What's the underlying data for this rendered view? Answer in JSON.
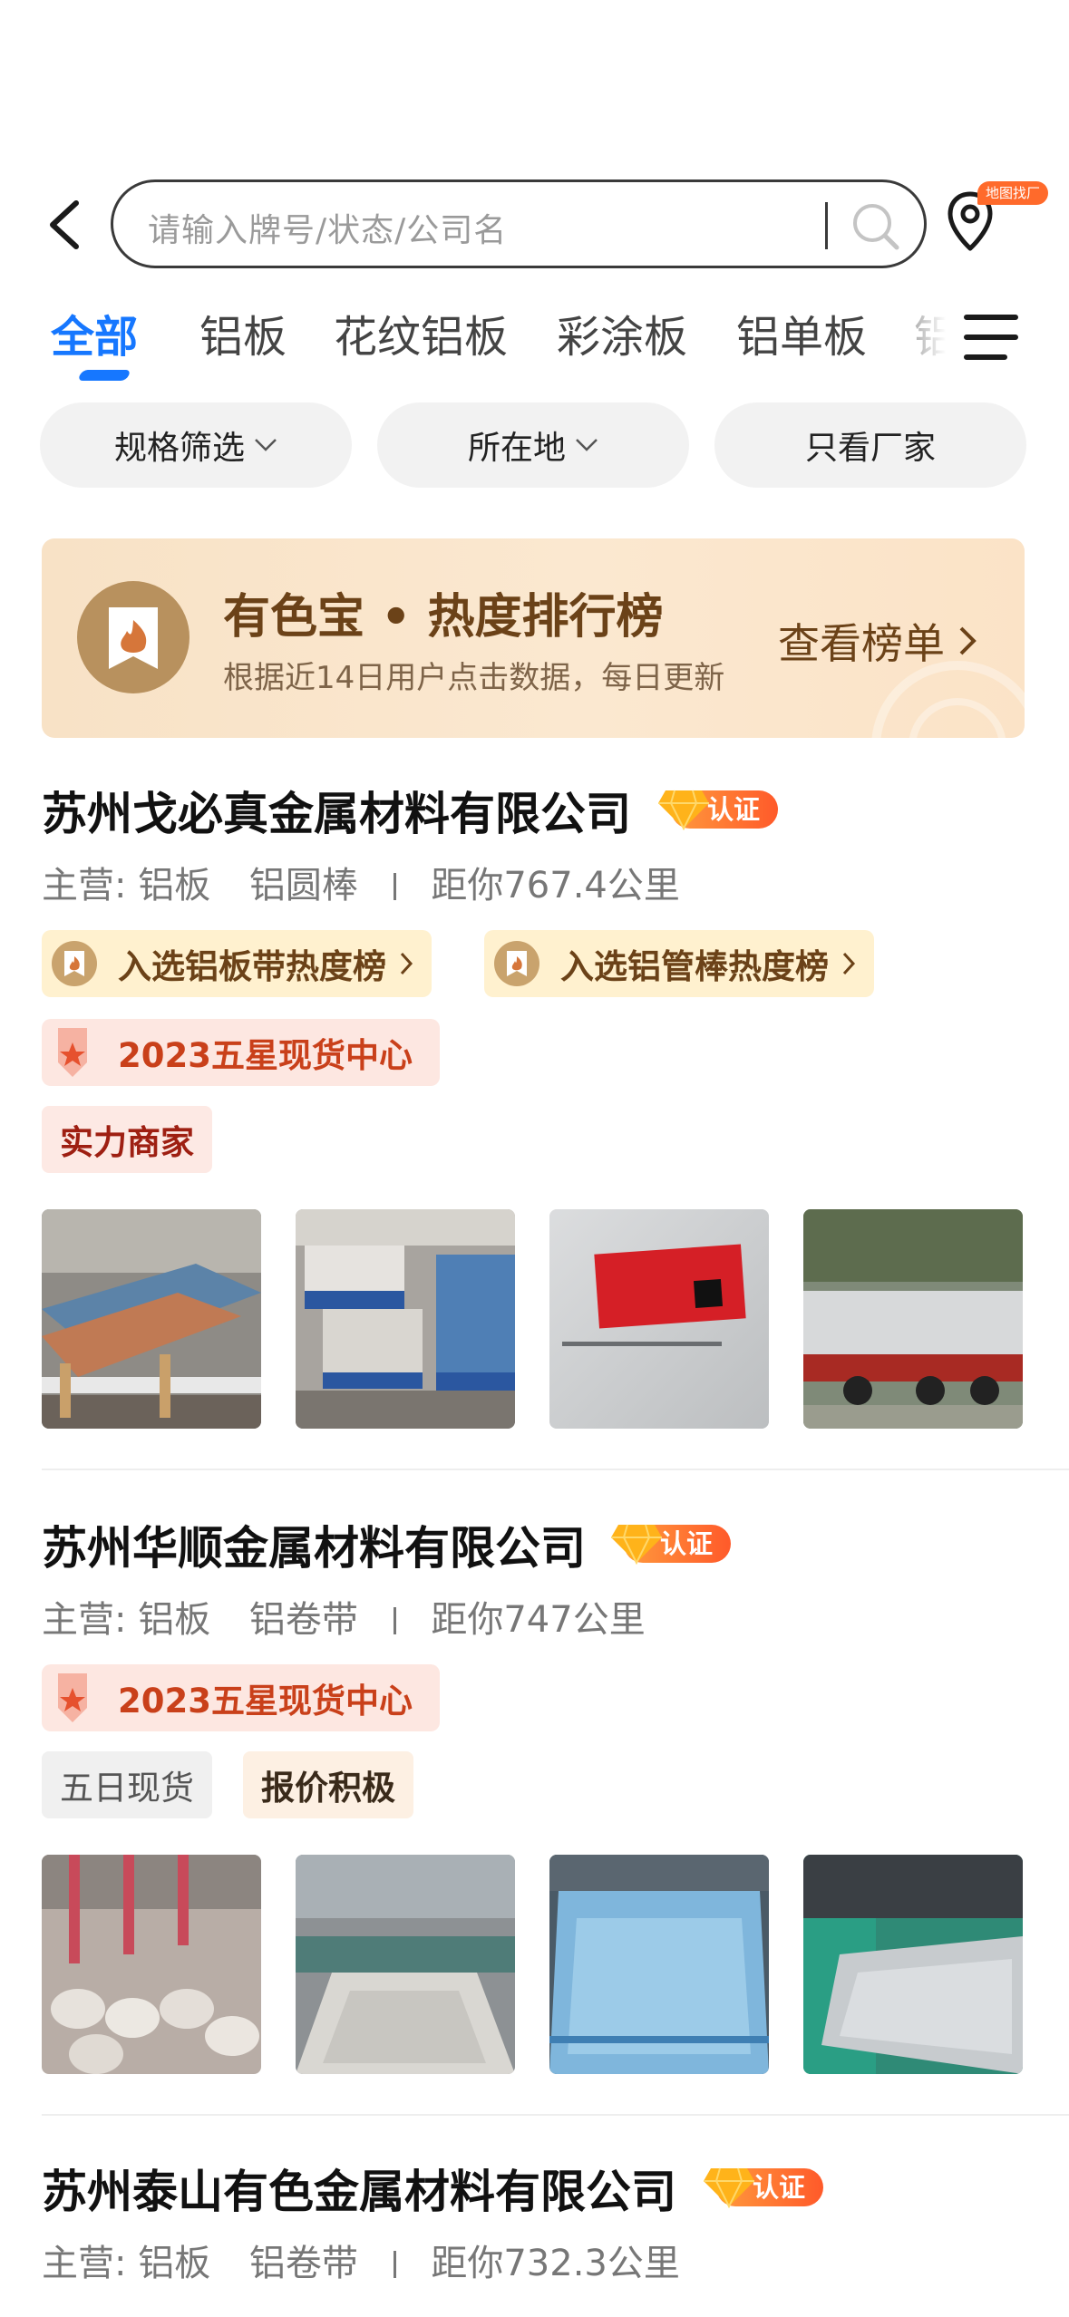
{
  "search": {
    "placeholder": "请输入牌号/状态/公司名",
    "map_badge": "地图找厂"
  },
  "tabs": [
    {
      "label": "全部",
      "active": true
    },
    {
      "label": "铝板",
      "active": false
    },
    {
      "label": "花纹铝板",
      "active": false
    },
    {
      "label": "彩涂板",
      "active": false
    },
    {
      "label": "铝单板",
      "active": false
    },
    {
      "label": "铝",
      "active": false
    }
  ],
  "filters": [
    {
      "label": "规格筛选",
      "has_dropdown": true
    },
    {
      "label": "所在地",
      "has_dropdown": true
    },
    {
      "label": "只看厂家",
      "has_dropdown": false
    }
  ],
  "banner": {
    "title": "有色宝 • 热度排行榜",
    "subtitle": "根据近14日用户点击数据，每日更新",
    "link": "查看榜单"
  },
  "companies": [
    {
      "name": "苏州戈必真金属材料有限公司",
      "cert": "认证",
      "main_label": "主营:",
      "products": [
        "铝板",
        "铝圆棒"
      ],
      "distance": "距你767.4公里",
      "rank_tags": [
        "入选铝板带热度榜",
        "入选铝管棒热度榜"
      ],
      "star_tag": "2023五星现货中心",
      "tags": [
        "实力商家"
      ],
      "photos": [
        "aluminum-plate-stack",
        "aluminum-plate-warehouse",
        "aluminum-plate-label",
        "aluminum-bar-truck"
      ]
    },
    {
      "name": "苏州华顺金属材料有限公司",
      "cert": "认证",
      "main_label": "主营:",
      "products": [
        "铝板",
        "铝卷带"
      ],
      "distance": "距你747公里",
      "star_tag": "2023五星现货中心",
      "tags": [
        "五日现货",
        "报价积极"
      ],
      "photos": [
        "aluminum-coil-factory",
        "aluminum-plate-workshop",
        "blue-film-plate",
        "cutting-machine-plate"
      ]
    },
    {
      "name": "苏州泰山有色金属材料有限公司",
      "cert": "认证",
      "main_label": "主营:",
      "products": [
        "铝板",
        "铝卷带"
      ],
      "distance": "距你732.3公里"
    }
  ],
  "colors": {
    "accent": "#1677ff",
    "banner_text": "#6b4218",
    "cert_orange": "#ff6a2b",
    "star_tag_red": "#c9401a"
  }
}
